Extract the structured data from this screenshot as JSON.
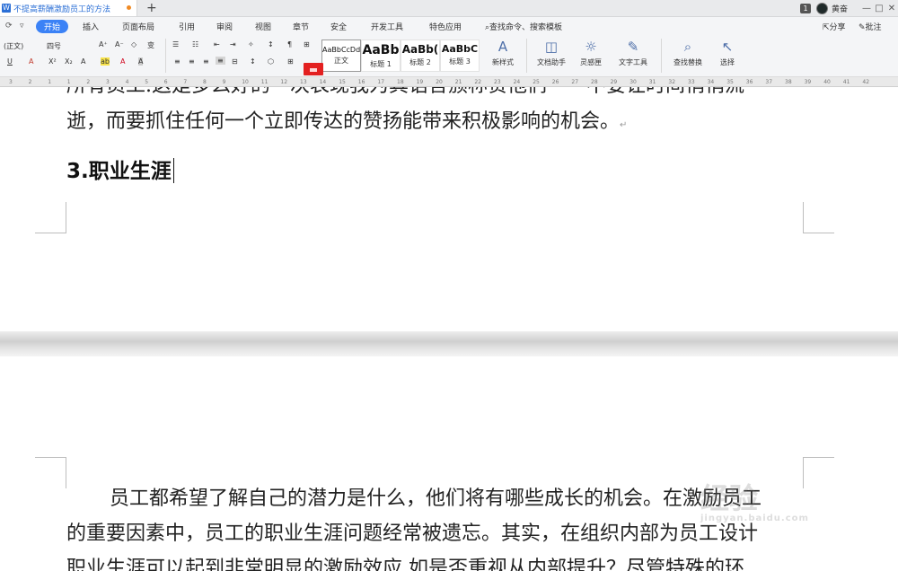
{
  "tabbar": {
    "doc_icon": "W",
    "doc_title": "不提高薪酬激励员工的方法",
    "new_tab": "+",
    "badge": "1",
    "username": "黄奋",
    "controls": [
      "—",
      "□",
      "✕"
    ]
  },
  "menubar": {
    "quick_icons": [
      "⟳",
      "▿"
    ],
    "items": [
      "开始",
      "插入",
      "页面布局",
      "引用",
      "审阅",
      "视图",
      "章节",
      "安全",
      "开发工具",
      "特色应用"
    ],
    "search_label": "查找命令、搜索模板",
    "right_items": [
      "分享",
      "批注"
    ]
  },
  "toolbar": {
    "style_value": "(正文)",
    "size_value": "四号",
    "font_buttons_row1": [
      "A⁺",
      "A⁻",
      "◇",
      "变"
    ],
    "font_buttons_row2": [
      "U",
      "A",
      "X²",
      "X₂",
      "A",
      "ab",
      "A",
      "A"
    ],
    "para_row1": [
      "☰",
      "☷",
      "⇤",
      "⇥",
      "✧",
      "↕",
      "¶",
      "⊞"
    ],
    "para_row2": [
      "≡",
      "≡",
      "≡",
      "≡",
      "⊟",
      "↕",
      "⬡",
      "⊞"
    ],
    "styles": [
      {
        "sample": "AaBbCcDd",
        "label": "正文"
      },
      {
        "sample": "AaBb",
        "label": "标题 1"
      },
      {
        "sample": "AaBb(",
        "label": "标题 2"
      },
      {
        "sample": "AaBbC",
        "label": "标题 3"
      }
    ],
    "big_tools": [
      {
        "icon": "A",
        "label": "新样式"
      },
      {
        "icon": "◫",
        "label": "文档助手"
      },
      {
        "icon": "☼",
        "label": "灵感匣"
      },
      {
        "icon": "✎",
        "label": "文字工具"
      },
      {
        "icon": "⌕",
        "label": "查找替换"
      },
      {
        "icon": "↖",
        "label": "选择"
      }
    ]
  },
  "ruler": {
    "ticks": [
      "3",
      "2",
      "1",
      "1",
      "2",
      "3",
      "4",
      "5",
      "6",
      "7",
      "8",
      "9",
      "10",
      "11",
      "12",
      "13",
      "14",
      "15",
      "16",
      "17",
      "18",
      "19",
      "20",
      "21",
      "22",
      "23",
      "24",
      "25",
      "26",
      "27",
      "28",
      "29",
      "30",
      "31",
      "32",
      "33",
      "34",
      "35",
      "36",
      "37",
      "38",
      "39",
      "40",
      "41",
      "42"
    ]
  },
  "document": {
    "clipped_line": "所有员工.这是多么好的一次表现我为其语言颁称赞他们——不要让时间悄悄流",
    "line2": "逝，而要抓住任何一个立即传达的赞扬能带来积极影响的机会。",
    "heading": "3.职业生涯",
    "para2_line1": "员工都希望了解自己的潜力是什么，他们将有哪些成长的机会。在激励员工",
    "para2_line2": "的重要因素中，员工的职业生涯问题经常被遗忘。其实，在组织内部为员工设计",
    "para2_line3": "职业生涯可以起到非常明显的激励效应.如是否重视从内部提升？尽管特殊的环"
  },
  "watermark": {
    "main": "经验",
    "sub": "jingyan.baidu.com"
  }
}
